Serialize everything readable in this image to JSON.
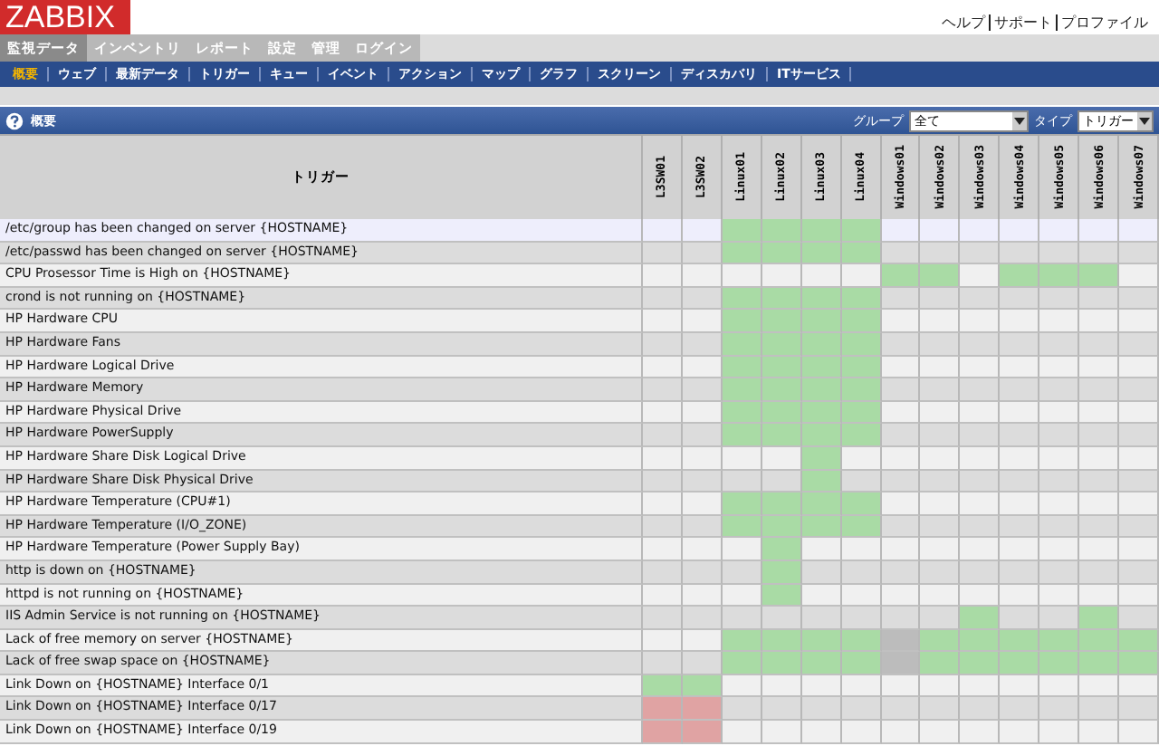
{
  "logo": "ZABBIX",
  "header_links": [
    "ヘルプ",
    "サポート",
    "プロファイル"
  ],
  "main_tabs": [
    {
      "label": "監視データ",
      "selected": true
    },
    {
      "label": "インベントリ",
      "selected": false
    },
    {
      "label": "レポート",
      "selected": false
    },
    {
      "label": "設定",
      "selected": false
    },
    {
      "label": "管理",
      "selected": false
    },
    {
      "label": "ログイン",
      "selected": false
    }
  ],
  "sub_tabs": [
    {
      "label": "概要",
      "selected": true
    },
    {
      "label": "ウェブ",
      "selected": false
    },
    {
      "label": "最新データ",
      "selected": false
    },
    {
      "label": "トリガー",
      "selected": false
    },
    {
      "label": "キュー",
      "selected": false
    },
    {
      "label": "イベント",
      "selected": false
    },
    {
      "label": "アクション",
      "selected": false
    },
    {
      "label": "マップ",
      "selected": false
    },
    {
      "label": "グラフ",
      "selected": false
    },
    {
      "label": "スクリーン",
      "selected": false
    },
    {
      "label": "ディスカバリ",
      "selected": false
    },
    {
      "label": "ITサービス",
      "selected": false
    }
  ],
  "panel": {
    "title": "概要",
    "filters": [
      {
        "label": "グループ",
        "value": "全て"
      },
      {
        "label": "タイプ",
        "value": "トリガー"
      }
    ]
  },
  "table": {
    "columns": [
      "トリガー",
      "L3SW01",
      "L3SW02",
      "Linux01",
      "Linux02",
      "Linux03",
      "Linux04",
      "Windows01",
      "Windows02",
      "Windows03",
      "Windows04",
      "Windows05",
      "Windows06",
      "Windows07"
    ],
    "rows": [
      {
        "trigger": "/etc/group has been changed on server {HOSTNAME}",
        "highlighted": true,
        "cells": [
          {
            "filled": false
          },
          {
            "filled": false
          },
          {
            "filled": true,
            "color": "#a9dba5"
          },
          {
            "filled": true,
            "color": "#a9dba5"
          },
          {
            "filled": true,
            "color": "#a9dba5"
          },
          {
            "filled": true,
            "color": "#a9dba5"
          },
          {
            "filled": false
          },
          {
            "filled": false
          },
          {
            "filled": false
          },
          {
            "filled": false
          },
          {
            "filled": false
          },
          {
            "filled": false
          },
          {
            "filled": false
          }
        ]
      },
      {
        "trigger": "/etc/passwd has been changed on server {HOSTNAME}",
        "highlighted": false,
        "cells": [
          {
            "filled": false
          },
          {
            "filled": false
          },
          {
            "filled": true,
            "color": "#a9dba5"
          },
          {
            "filled": true,
            "color": "#a9dba5"
          },
          {
            "filled": true,
            "color": "#a9dba5"
          },
          {
            "filled": true,
            "color": "#a9dba5"
          },
          {
            "filled": false
          },
          {
            "filled": false
          },
          {
            "filled": false
          },
          {
            "filled": false
          },
          {
            "filled": false
          },
          {
            "filled": false
          },
          {
            "filled": false
          }
        ]
      },
      {
        "trigger": "CPU Prosessor Time is High on {HOSTNAME}",
        "highlighted": false,
        "cells": [
          {
            "filled": false
          },
          {
            "filled": false
          },
          {
            "filled": false
          },
          {
            "filled": false
          },
          {
            "filled": false
          },
          {
            "filled": false
          },
          {
            "filled": true,
            "color": "#a9dba5"
          },
          {
            "filled": true,
            "color": "#a9dba5"
          },
          {
            "filled": false
          },
          {
            "filled": true,
            "color": "#a9dba5"
          },
          {
            "filled": true,
            "color": "#a9dba5"
          },
          {
            "filled": true,
            "color": "#a9dba5"
          },
          {
            "filled": false
          }
        ]
      },
      {
        "trigger": "crond is not running on {HOSTNAME}",
        "highlighted": false,
        "cells": [
          {
            "filled": false
          },
          {
            "filled": false
          },
          {
            "filled": true,
            "color": "#a9dba5"
          },
          {
            "filled": true,
            "color": "#a9dba5"
          },
          {
            "filled": true,
            "color": "#a9dba5"
          },
          {
            "filled": true,
            "color": "#a9dba5"
          },
          {
            "filled": false
          },
          {
            "filled": false
          },
          {
            "filled": false
          },
          {
            "filled": false
          },
          {
            "filled": false
          },
          {
            "filled": false
          },
          {
            "filled": false
          }
        ]
      },
      {
        "trigger": "HP Hardware CPU",
        "highlighted": false,
        "cells": [
          {
            "filled": false
          },
          {
            "filled": false
          },
          {
            "filled": true,
            "color": "#a9dba5"
          },
          {
            "filled": true,
            "color": "#a9dba5"
          },
          {
            "filled": true,
            "color": "#a9dba5"
          },
          {
            "filled": true,
            "color": "#a9dba5"
          },
          {
            "filled": false
          },
          {
            "filled": false
          },
          {
            "filled": false
          },
          {
            "filled": false
          },
          {
            "filled": false
          },
          {
            "filled": false
          },
          {
            "filled": false
          }
        ]
      },
      {
        "trigger": "HP Hardware Fans",
        "highlighted": false,
        "cells": [
          {
            "filled": false
          },
          {
            "filled": false
          },
          {
            "filled": true,
            "color": "#a9dba5"
          },
          {
            "filled": true,
            "color": "#a9dba5"
          },
          {
            "filled": true,
            "color": "#a9dba5"
          },
          {
            "filled": true,
            "color": "#a9dba5"
          },
          {
            "filled": false
          },
          {
            "filled": false
          },
          {
            "filled": false
          },
          {
            "filled": false
          },
          {
            "filled": false
          },
          {
            "filled": false
          },
          {
            "filled": false
          }
        ]
      },
      {
        "trigger": "HP Hardware Logical Drive",
        "highlighted": false,
        "cells": [
          {
            "filled": false
          },
          {
            "filled": false
          },
          {
            "filled": true,
            "color": "#a9dba5"
          },
          {
            "filled": true,
            "color": "#a9dba5"
          },
          {
            "filled": true,
            "color": "#a9dba5"
          },
          {
            "filled": true,
            "color": "#a9dba5"
          },
          {
            "filled": false
          },
          {
            "filled": false
          },
          {
            "filled": false
          },
          {
            "filled": false
          },
          {
            "filled": false
          },
          {
            "filled": false
          },
          {
            "filled": false
          }
        ]
      },
      {
        "trigger": "HP Hardware Memory",
        "highlighted": false,
        "cells": [
          {
            "filled": false
          },
          {
            "filled": false
          },
          {
            "filled": true,
            "color": "#a9dba5"
          },
          {
            "filled": true,
            "color": "#a9dba5"
          },
          {
            "filled": true,
            "color": "#a9dba5"
          },
          {
            "filled": true,
            "color": "#a9dba5"
          },
          {
            "filled": false
          },
          {
            "filled": false
          },
          {
            "filled": false
          },
          {
            "filled": false
          },
          {
            "filled": false
          },
          {
            "filled": false
          },
          {
            "filled": false
          }
        ]
      },
      {
        "trigger": "HP Hardware Physical Drive",
        "highlighted": false,
        "cells": [
          {
            "filled": false
          },
          {
            "filled": false
          },
          {
            "filled": true,
            "color": "#a9dba5"
          },
          {
            "filled": true,
            "color": "#a9dba5"
          },
          {
            "filled": true,
            "color": "#a9dba5"
          },
          {
            "filled": true,
            "color": "#a9dba5"
          },
          {
            "filled": false
          },
          {
            "filled": false
          },
          {
            "filled": false
          },
          {
            "filled": false
          },
          {
            "filled": false
          },
          {
            "filled": false
          },
          {
            "filled": false
          }
        ]
      },
      {
        "trigger": "HP Hardware PowerSupply",
        "highlighted": false,
        "cells": [
          {
            "filled": false
          },
          {
            "filled": false
          },
          {
            "filled": true,
            "color": "#a9dba5"
          },
          {
            "filled": true,
            "color": "#a9dba5"
          },
          {
            "filled": true,
            "color": "#a9dba5"
          },
          {
            "filled": true,
            "color": "#a9dba5"
          },
          {
            "filled": false
          },
          {
            "filled": false
          },
          {
            "filled": false
          },
          {
            "filled": false
          },
          {
            "filled": false
          },
          {
            "filled": false
          },
          {
            "filled": false
          }
        ]
      },
      {
        "trigger": "HP Hardware Share Disk Logical Drive",
        "highlighted": false,
        "cells": [
          {
            "filled": false
          },
          {
            "filled": false
          },
          {
            "filled": false
          },
          {
            "filled": false
          },
          {
            "filled": true,
            "color": "#a9dba5"
          },
          {
            "filled": false
          },
          {
            "filled": false
          },
          {
            "filled": false
          },
          {
            "filled": false
          },
          {
            "filled": false
          },
          {
            "filled": false
          },
          {
            "filled": false
          },
          {
            "filled": false
          }
        ]
      },
      {
        "trigger": "HP Hardware Share Disk Physical Drive",
        "highlighted": false,
        "cells": [
          {
            "filled": false
          },
          {
            "filled": false
          },
          {
            "filled": false
          },
          {
            "filled": false
          },
          {
            "filled": true,
            "color": "#a9dba5"
          },
          {
            "filled": false
          },
          {
            "filled": false
          },
          {
            "filled": false
          },
          {
            "filled": false
          },
          {
            "filled": false
          },
          {
            "filled": false
          },
          {
            "filled": false
          },
          {
            "filled": false
          }
        ]
      },
      {
        "trigger": "HP Hardware Temperature (CPU#1)",
        "highlighted": false,
        "cells": [
          {
            "filled": false
          },
          {
            "filled": false
          },
          {
            "filled": true,
            "color": "#a9dba5"
          },
          {
            "filled": true,
            "color": "#a9dba5"
          },
          {
            "filled": true,
            "color": "#a9dba5"
          },
          {
            "filled": true,
            "color": "#a9dba5"
          },
          {
            "filled": false
          },
          {
            "filled": false
          },
          {
            "filled": false
          },
          {
            "filled": false
          },
          {
            "filled": false
          },
          {
            "filled": false
          },
          {
            "filled": false
          }
        ]
      },
      {
        "trigger": "HP Hardware Temperature (I/O_ZONE)",
        "highlighted": false,
        "cells": [
          {
            "filled": false
          },
          {
            "filled": false
          },
          {
            "filled": true,
            "color": "#a9dba5"
          },
          {
            "filled": true,
            "color": "#a9dba5"
          },
          {
            "filled": true,
            "color": "#a9dba5"
          },
          {
            "filled": true,
            "color": "#a9dba5"
          },
          {
            "filled": false
          },
          {
            "filled": false
          },
          {
            "filled": false
          },
          {
            "filled": false
          },
          {
            "filled": false
          },
          {
            "filled": false
          },
          {
            "filled": false
          }
        ]
      },
      {
        "trigger": "HP Hardware Temperature (Power Supply Bay)",
        "highlighted": false,
        "cells": [
          {
            "filled": false
          },
          {
            "filled": false
          },
          {
            "filled": false
          },
          {
            "filled": true,
            "color": "#a9dba5"
          },
          {
            "filled": false
          },
          {
            "filled": false
          },
          {
            "filled": false
          },
          {
            "filled": false
          },
          {
            "filled": false
          },
          {
            "filled": false
          },
          {
            "filled": false
          },
          {
            "filled": false
          },
          {
            "filled": false
          }
        ]
      },
      {
        "trigger": "http is down on {HOSTNAME}",
        "highlighted": false,
        "cells": [
          {
            "filled": false
          },
          {
            "filled": false
          },
          {
            "filled": false
          },
          {
            "filled": true,
            "color": "#a9dba5"
          },
          {
            "filled": false
          },
          {
            "filled": false
          },
          {
            "filled": false
          },
          {
            "filled": false
          },
          {
            "filled": false
          },
          {
            "filled": false
          },
          {
            "filled": false
          },
          {
            "filled": false
          },
          {
            "filled": false
          }
        ]
      },
      {
        "trigger": "httpd is not running on {HOSTNAME}",
        "highlighted": false,
        "cells": [
          {
            "filled": false
          },
          {
            "filled": false
          },
          {
            "filled": false
          },
          {
            "filled": true,
            "color": "#a9dba5"
          },
          {
            "filled": false
          },
          {
            "filled": false
          },
          {
            "filled": false
          },
          {
            "filled": false
          },
          {
            "filled": false
          },
          {
            "filled": false
          },
          {
            "filled": false
          },
          {
            "filled": false
          },
          {
            "filled": false
          }
        ]
      },
      {
        "trigger": "IIS Admin Service is not running on {HOSTNAME}",
        "highlighted": false,
        "cells": [
          {
            "filled": false
          },
          {
            "filled": false
          },
          {
            "filled": false
          },
          {
            "filled": false
          },
          {
            "filled": false
          },
          {
            "filled": false
          },
          {
            "filled": false
          },
          {
            "filled": false
          },
          {
            "filled": true,
            "color": "#a9dba5"
          },
          {
            "filled": false
          },
          {
            "filled": false
          },
          {
            "filled": true,
            "color": "#a9dba5"
          },
          {
            "filled": false
          }
        ]
      },
      {
        "trigger": "Lack of free memory on server {HOSTNAME}",
        "highlighted": false,
        "cells": [
          {
            "filled": false
          },
          {
            "filled": false
          },
          {
            "filled": true,
            "color": "#a9dba5"
          },
          {
            "filled": true,
            "color": "#a9dba5"
          },
          {
            "filled": true,
            "color": "#a9dba5"
          },
          {
            "filled": true,
            "color": "#a9dba5"
          },
          {
            "filled": true,
            "color": "#bcbcbc"
          },
          {
            "filled": true,
            "color": "#a9dba5"
          },
          {
            "filled": true,
            "color": "#a9dba5"
          },
          {
            "filled": true,
            "color": "#a9dba5"
          },
          {
            "filled": true,
            "color": "#a9dba5"
          },
          {
            "filled": true,
            "color": "#a9dba5"
          },
          {
            "filled": true,
            "color": "#a9dba5"
          }
        ]
      },
      {
        "trigger": "Lack of free swap space on {HOSTNAME}",
        "highlighted": false,
        "cells": [
          {
            "filled": false
          },
          {
            "filled": false
          },
          {
            "filled": true,
            "color": "#a9dba5"
          },
          {
            "filled": true,
            "color": "#a9dba5"
          },
          {
            "filled": true,
            "color": "#a9dba5"
          },
          {
            "filled": true,
            "color": "#a9dba5"
          },
          {
            "filled": true,
            "color": "#bcbcbc"
          },
          {
            "filled": true,
            "color": "#a9dba5"
          },
          {
            "filled": true,
            "color": "#a9dba5"
          },
          {
            "filled": true,
            "color": "#a9dba5"
          },
          {
            "filled": true,
            "color": "#a9dba5"
          },
          {
            "filled": true,
            "color": "#a9dba5"
          },
          {
            "filled": true,
            "color": "#a9dba5"
          }
        ]
      },
      {
        "trigger": "Link Down on {HOSTNAME} Interface 0/1",
        "highlighted": false,
        "cells": [
          {
            "filled": true,
            "color": "#a9dba5"
          },
          {
            "filled": true,
            "color": "#a9dba5"
          },
          {
            "filled": false
          },
          {
            "filled": false
          },
          {
            "filled": false
          },
          {
            "filled": false
          },
          {
            "filled": false
          },
          {
            "filled": false
          },
          {
            "filled": false
          },
          {
            "filled": false
          },
          {
            "filled": false
          },
          {
            "filled": false
          },
          {
            "filled": false
          }
        ]
      },
      {
        "trigger": "Link Down on {HOSTNAME} Interface 0/17",
        "highlighted": false,
        "cells": [
          {
            "filled": true,
            "color": "#e0a3a3"
          },
          {
            "filled": true,
            "color": "#e0a3a3"
          },
          {
            "filled": false
          },
          {
            "filled": false
          },
          {
            "filled": false
          },
          {
            "filled": false
          },
          {
            "filled": false
          },
          {
            "filled": false
          },
          {
            "filled": false
          },
          {
            "filled": false
          },
          {
            "filled": false
          },
          {
            "filled": false
          },
          {
            "filled": false
          }
        ]
      },
      {
        "trigger": "Link Down on {HOSTNAME} Interface 0/19",
        "highlighted": false,
        "cells": [
          {
            "filled": true,
            "color": "#e0a3a3"
          },
          {
            "filled": true,
            "color": "#e0a3a3"
          },
          {
            "filled": false
          },
          {
            "filled": false
          },
          {
            "filled": false
          },
          {
            "filled": false
          },
          {
            "filled": false
          },
          {
            "filled": false
          },
          {
            "filled": false
          },
          {
            "filled": false
          },
          {
            "filled": false
          },
          {
            "filled": false
          },
          {
            "filled": false
          }
        ]
      }
    ]
  }
}
